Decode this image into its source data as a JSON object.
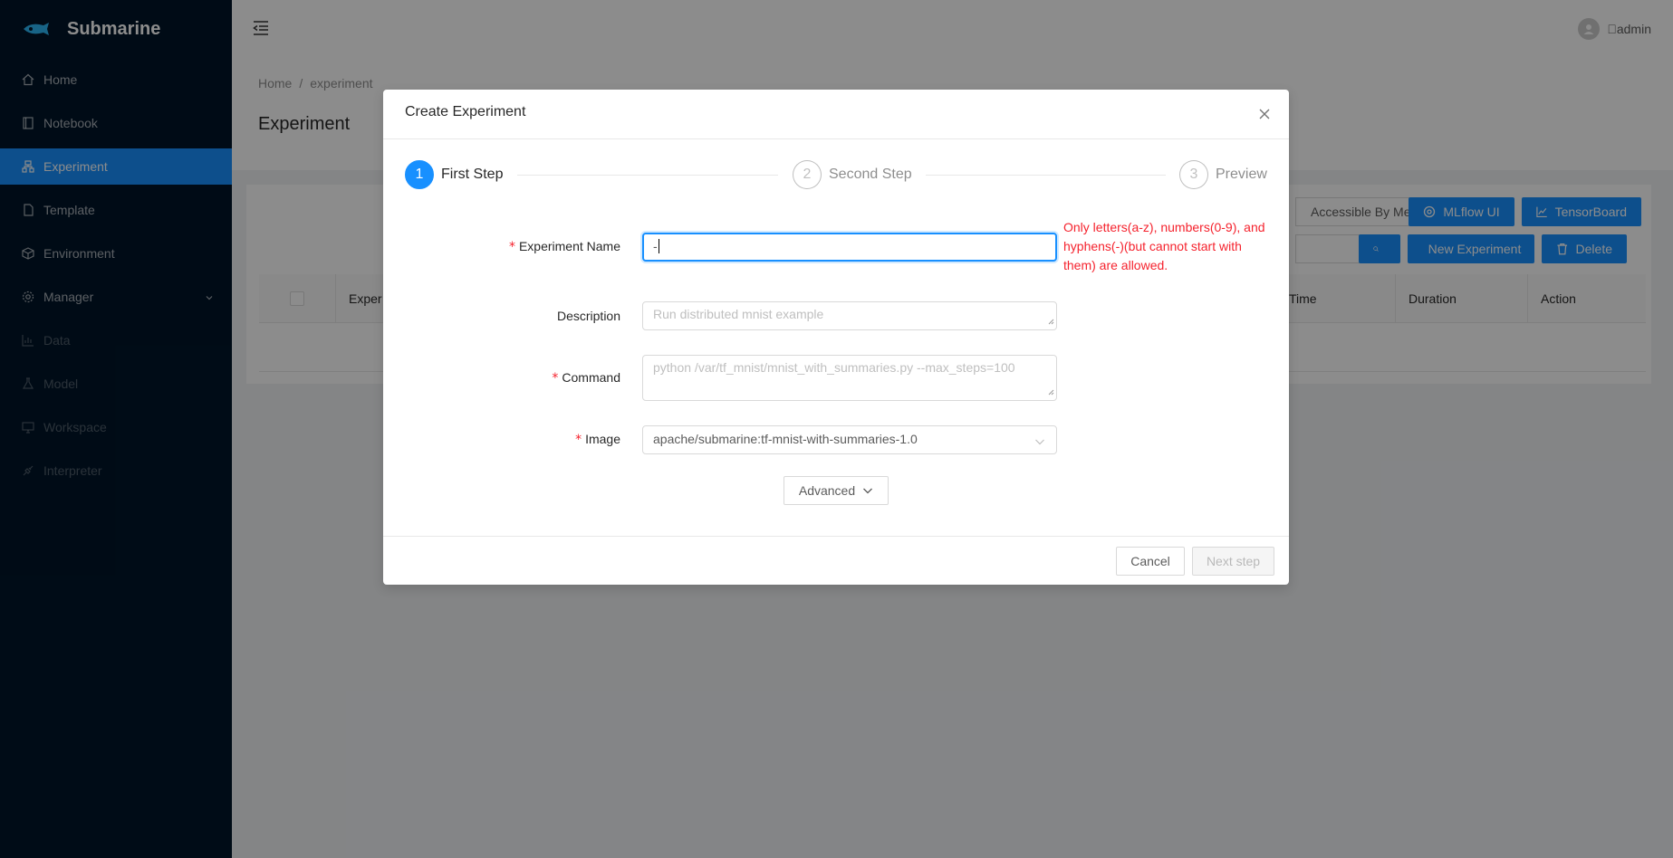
{
  "app": {
    "title": "Submarine"
  },
  "sidebar": {
    "items": [
      {
        "label": "Home",
        "icon": "home-icon"
      },
      {
        "label": "Notebook",
        "icon": "book-icon"
      },
      {
        "label": "Experiment",
        "icon": "cluster-icon"
      },
      {
        "label": "Template",
        "icon": "file-icon"
      },
      {
        "label": "Environment",
        "icon": "code-sandbox-icon"
      },
      {
        "label": "Manager",
        "icon": "setting-icon"
      },
      {
        "label": "Data",
        "icon": "bar-chart-icon"
      },
      {
        "label": "Model",
        "icon": "experiment-icon"
      },
      {
        "label": "Workspace",
        "icon": "desktop-icon"
      },
      {
        "label": "Interpreter",
        "icon": "api-icon"
      }
    ]
  },
  "header": {
    "username": "\u0000admin"
  },
  "breadcrumb": {
    "home": "Home",
    "separator": "/",
    "current": "experiment"
  },
  "page": {
    "title": "Experiment"
  },
  "toolbar": {
    "filter_label": "Accessible By Me",
    "mlflow_label": "MLflow UI",
    "tensorboard_label": "TensorBoard",
    "new_label": "New Experiment",
    "delete_label": "Delete"
  },
  "table": {
    "columns": [
      "Exper",
      "Time",
      "Duration",
      "Action"
    ]
  },
  "modal": {
    "title": "Create Experiment",
    "steps": [
      {
        "number": "1",
        "label": "First Step"
      },
      {
        "number": "2",
        "label": "Second Step"
      },
      {
        "number": "3",
        "label": "Preview"
      }
    ],
    "form": {
      "name_label": "Experiment Name",
      "name_value": "-",
      "name_error": "Only letters(a-z), numbers(0-9), and hyphens(-)(but cannot start with them) are allowed.",
      "description_label": "Description",
      "description_placeholder": "Run distributed mnist example",
      "command_label": "Command",
      "command_placeholder": "python /var/tf_mnist/mnist_with_summaries.py --max_steps=100",
      "image_label": "Image",
      "image_value": "apache/submarine:tf-mnist-with-summaries-1.0"
    },
    "advanced_label": "Advanced",
    "cancel_label": "Cancel",
    "next_label": "Next step"
  },
  "colors": {
    "primary": "#1890ff",
    "sidebar_bg": "#001529",
    "error": "#f5222d"
  }
}
